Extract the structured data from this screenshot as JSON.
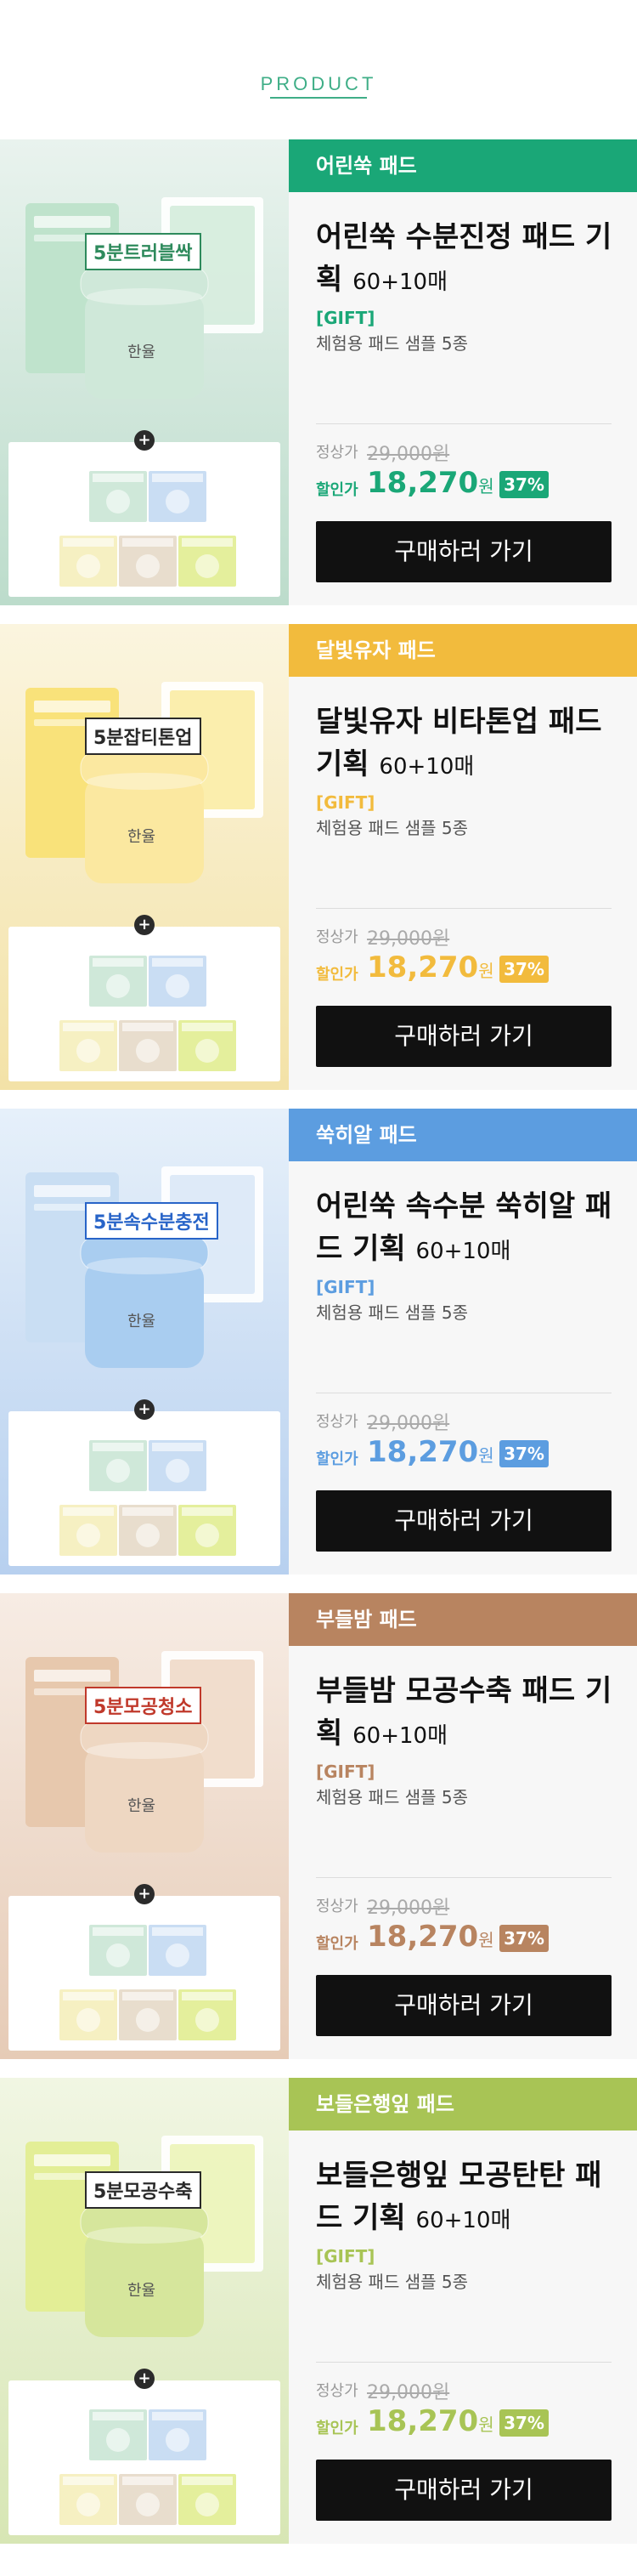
{
  "header": {
    "title": "PRODUCT"
  },
  "products": [
    {
      "category": "어린쑥 패드",
      "title": "어린쑥 수분진정 패드 기획",
      "count": "60+10매",
      "gift_label": "[GIFT]",
      "gift_desc": "체험용 패드 샘플 5종",
      "orig_label": "정상가",
      "orig_price": "29,000원",
      "sale_label": "할인가",
      "sale_price": "18,270",
      "sale_unit": "원",
      "discount": "37%",
      "button": "구매하러 가기",
      "box_text": "5분트러블싹",
      "jar_text": "한율",
      "accent": "#1aa777"
    },
    {
      "category": "달빛유자 패드",
      "title": "달빛유자 비타톤업 패드 기획",
      "count": "60+10매",
      "gift_label": "[GIFT]",
      "gift_desc": "체험용 패드 샘플 5종",
      "orig_label": "정상가",
      "orig_price": "29,000원",
      "sale_label": "할인가",
      "sale_price": "18,270",
      "sale_unit": "원",
      "discount": "37%",
      "button": "구매하러 가기",
      "box_text": "5분잡티톤업",
      "jar_text": "한율",
      "accent": "#f2bb3d"
    },
    {
      "category": "쑥히알 패드",
      "title": "어린쑥 속수분 쑥히알 패드 기획",
      "count": "60+10매",
      "gift_label": "[GIFT]",
      "gift_desc": "체험용 패드 샘플 5종",
      "orig_label": "정상가",
      "orig_price": "29,000원",
      "sale_label": "할인가",
      "sale_price": "18,270",
      "sale_unit": "원",
      "discount": "37%",
      "button": "구매하러 가기",
      "box_text": "5분속수분충전",
      "jar_text": "한율",
      "accent": "#5c9de0"
    },
    {
      "category": "부들밤 패드",
      "title": "부들밤 모공수축 패드 기획",
      "count": "60+10매",
      "gift_label": "[GIFT]",
      "gift_desc": "체험용 패드 샘플 5종",
      "orig_label": "정상가",
      "orig_price": "29,000원",
      "sale_label": "할인가",
      "sale_price": "18,270",
      "sale_unit": "원",
      "discount": "37%",
      "button": "구매하러 가기",
      "box_text": "5분모공청소",
      "jar_text": "한율",
      "accent": "#b88460"
    },
    {
      "category": "보들은행잎 패드",
      "title": "보들은행잎 모공탄탄 패드 기획",
      "count": "60+10매",
      "gift_label": "[GIFT]",
      "gift_desc": "체험용 패드 샘플 5종",
      "orig_label": "정상가",
      "orig_price": "29,000원",
      "sale_label": "할인가",
      "sale_price": "18,270",
      "sale_unit": "원",
      "discount": "37%",
      "button": "구매하러 가기",
      "box_text": "5분모공수축",
      "jar_text": "한율",
      "accent": "#a8c455"
    }
  ],
  "themes": [
    {
      "bg_top": "#e9f3ee",
      "bg_bottom": "#bcdccb",
      "jar": "#cfe8d9",
      "pouch": "#bfe3cc",
      "box": "#2e8a5c"
    },
    {
      "bg_top": "#fbf5df",
      "bg_bottom": "#f3e2a7",
      "jar": "#fbe8a0",
      "pouch": "#f9e27a",
      "box": "#2a2a2a"
    },
    {
      "bg_top": "#e6f0fa",
      "bg_bottom": "#b7d0ef",
      "jar": "#a9cdf0",
      "pouch": "#c9def3",
      "box": "#2864c8"
    },
    {
      "bg_top": "#f7ece4",
      "bg_bottom": "#e6cbb6",
      "jar": "#eed7c2",
      "pouch": "#e7c8ad",
      "box": "#c0392b"
    },
    {
      "bg_top": "#f1f6e3",
      "bg_bottom": "#d7e6b4",
      "jar": "#d6e69c",
      "pouch": "#e3ee96",
      "box": "#2a2a2a"
    }
  ],
  "sample_colors": [
    "#cfe8d9",
    "#c9ddf3",
    "#f6f0c2",
    "#e8ddcd",
    "#e4ef9c"
  ]
}
